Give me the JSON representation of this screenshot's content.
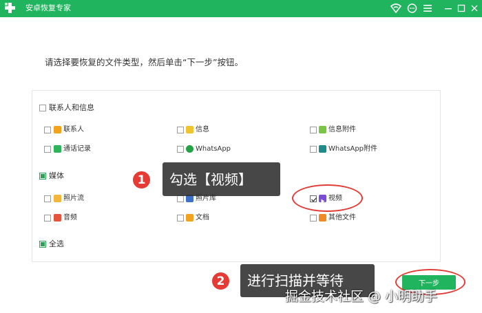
{
  "app": {
    "title": "安卓恢复专家"
  },
  "instruction": "请选择要恢复的文件类型，然后单击“下一步”按钮。",
  "groups": {
    "contacts": {
      "label": "联系人和信息",
      "items": [
        "联系人",
        "信息",
        "信息附件",
        "通话记录",
        "WhatsApp",
        "WhatsApp附件"
      ]
    },
    "media": {
      "label": "媒体",
      "items": [
        "照片流",
        "照片库",
        "视频",
        "音频",
        "文档",
        "其他文件"
      ]
    },
    "select_all": "全选"
  },
  "annotations": {
    "step1_number": "1",
    "step1_text": "勾选【视频】",
    "step2_number": "2",
    "step2_text": "进行扫描并等待"
  },
  "next_button": "下一步",
  "watermark": "掘金技术社区 @ 小明助手",
  "colors": {
    "brand_green": "#1fb45d",
    "annotation_red": "#e33b33"
  }
}
